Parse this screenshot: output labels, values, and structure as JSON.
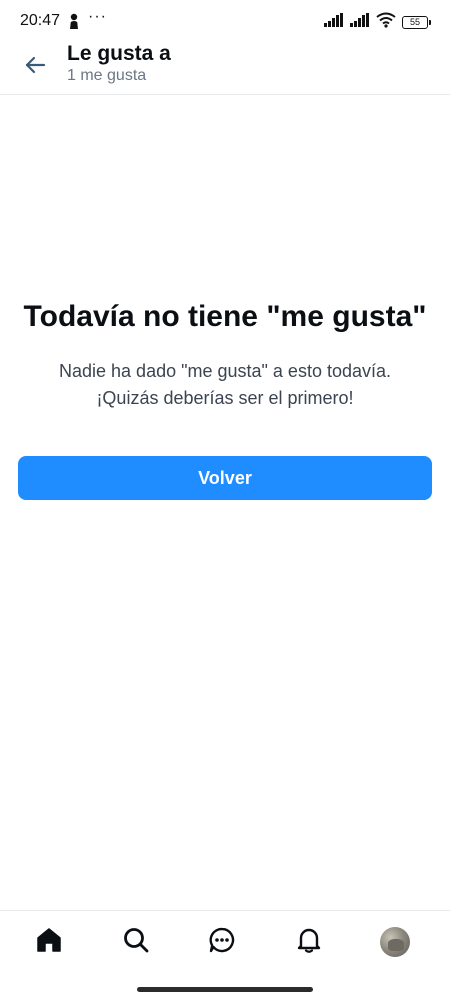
{
  "status_bar": {
    "time": "20:47",
    "overflow": "···",
    "battery": "55",
    "icons": [
      "person-icon",
      "signal-icon",
      "signal-icon",
      "wifi-icon",
      "battery-icon"
    ]
  },
  "header": {
    "title": "Le gusta a",
    "subtitle": "1 me gusta",
    "back_icon": "arrow-left-icon"
  },
  "empty_state": {
    "title": "Todavía no tiene \"me gusta\"",
    "message_line1": "Nadie ha dado \"me gusta\" a esto todavía.",
    "message_line2": "¡Quizás deberías ser el primero!",
    "button_label": "Volver"
  },
  "bottom_nav": {
    "items": [
      {
        "icon": "home-icon",
        "active": true
      },
      {
        "icon": "search-icon",
        "active": false
      },
      {
        "icon": "chat-icon",
        "active": false
      },
      {
        "icon": "bell-icon",
        "active": false
      },
      {
        "icon": "avatar",
        "active": false
      }
    ]
  },
  "colors": {
    "accent": "#1f8cff",
    "text": "#0b0f14",
    "muted": "#6b7785",
    "divider": "#e8ebee"
  }
}
